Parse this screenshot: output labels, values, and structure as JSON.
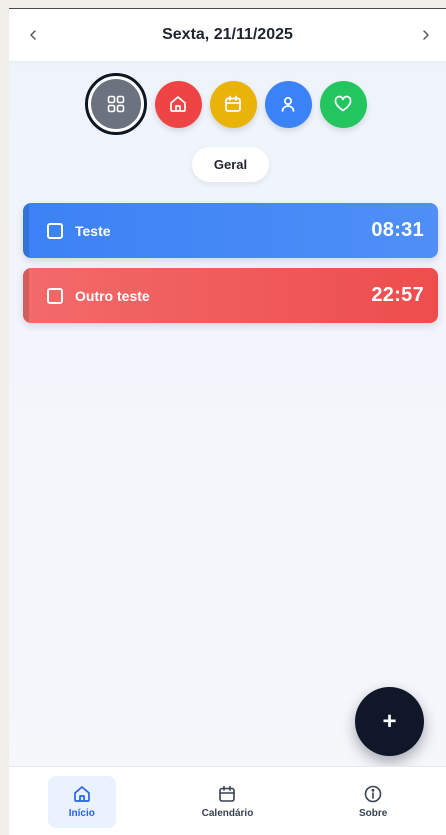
{
  "header": {
    "date_title": "Sexta, 21/11/2025",
    "prev_icon": "chevron-left-icon",
    "next_icon": "chevron-right-icon"
  },
  "categories": [
    {
      "id": "all",
      "icon": "grid-icon",
      "color": "#6b7280",
      "selected": true
    },
    {
      "id": "home",
      "icon": "home-icon",
      "color": "#ef4444",
      "selected": false
    },
    {
      "id": "calendar",
      "icon": "calendar-icon",
      "color": "#eab308",
      "selected": false
    },
    {
      "id": "person",
      "icon": "user-icon",
      "color": "#3b82f6",
      "selected": false
    },
    {
      "id": "health",
      "icon": "heart-icon",
      "color": "#22c55e",
      "selected": false
    }
  ],
  "filter_label": "Geral",
  "tasks": [
    {
      "name": "Teste",
      "time": "08:31",
      "color": "#3b82f6"
    },
    {
      "name": "Outro teste",
      "time": "22:57",
      "color": "#ef4444"
    }
  ],
  "fab_label": "+",
  "bottom_nav": [
    {
      "label": "Início",
      "icon": "home-icon",
      "active": true
    },
    {
      "label": "Calendário",
      "icon": "calendar-icon",
      "active": false
    },
    {
      "label": "Sobre",
      "icon": "info-icon",
      "active": false
    }
  ]
}
